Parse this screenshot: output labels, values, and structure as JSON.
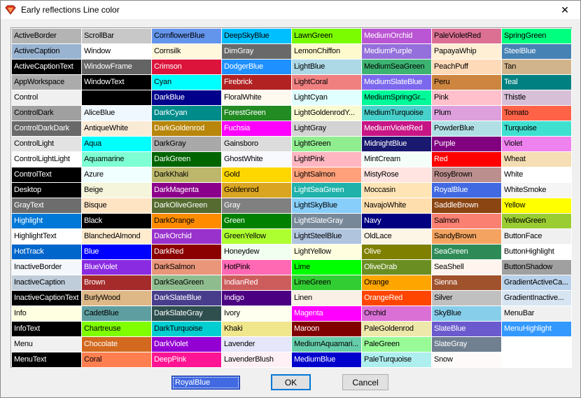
{
  "window": {
    "title": "Early reflections Line color",
    "close_glyph": "✕",
    "icon": "diamond-app-icon"
  },
  "selected": {
    "value": "RoyalBlue",
    "color": "#4169e1"
  },
  "buttons": {
    "ok": "OK",
    "cancel": "Cancel"
  },
  "columns": [
    [
      {
        "label": "ActiveBorder",
        "bg": "#b4b4b4",
        "fg": "#000000"
      },
      {
        "label": "ActiveCaption",
        "bg": "#99b4d1",
        "fg": "#000000"
      },
      {
        "label": "ActiveCaptionText",
        "bg": "#000000",
        "fg": "#ffffff"
      },
      {
        "label": "AppWorkspace",
        "bg": "#ababab",
        "fg": "#000000"
      },
      {
        "label": "Control",
        "bg": "#f0f0f0",
        "fg": "#000000"
      },
      {
        "label": "ControlDark",
        "bg": "#a0a0a0",
        "fg": "#000000"
      },
      {
        "label": "ControlDarkDark",
        "bg": "#696969",
        "fg": "#ffffff"
      },
      {
        "label": "ControlLight",
        "bg": "#e3e3e3",
        "fg": "#000000"
      },
      {
        "label": "ControlLightLight",
        "bg": "#ffffff",
        "fg": "#000000"
      },
      {
        "label": "ControlText",
        "bg": "#000000",
        "fg": "#ffffff"
      },
      {
        "label": "Desktop",
        "bg": "#000000",
        "fg": "#ffffff"
      },
      {
        "label": "GrayText",
        "bg": "#6d6d6d",
        "fg": "#ffffff"
      },
      {
        "label": "Highlight",
        "bg": "#0078d7",
        "fg": "#ffffff"
      },
      {
        "label": "HighlightText",
        "bg": "#ffffff",
        "fg": "#000000"
      },
      {
        "label": "HotTrack",
        "bg": "#0066cc",
        "fg": "#ffffff"
      },
      {
        "label": "InactiveBorder",
        "bg": "#f4f7fc",
        "fg": "#000000"
      },
      {
        "label": "InactiveCaption",
        "bg": "#bfcddb",
        "fg": "#000000"
      },
      {
        "label": "InactiveCaptionText",
        "bg": "#000000",
        "fg": "#ffffff"
      },
      {
        "label": "Info",
        "bg": "#ffffe1",
        "fg": "#000000"
      },
      {
        "label": "InfoText",
        "bg": "#000000",
        "fg": "#ffffff"
      },
      {
        "label": "Menu",
        "bg": "#f0f0f0",
        "fg": "#000000"
      },
      {
        "label": "MenuText",
        "bg": "#000000",
        "fg": "#ffffff"
      }
    ],
    [
      {
        "label": "ScrollBar",
        "bg": "#c8c8c8",
        "fg": "#000000"
      },
      {
        "label": "Window",
        "bg": "#ffffff",
        "fg": "#000000"
      },
      {
        "label": "WindowFrame",
        "bg": "#646464",
        "fg": "#ffffff"
      },
      {
        "label": "WindowText",
        "bg": "#000000",
        "fg": "#ffffff"
      },
      {
        "label": "",
        "bg": "#000000",
        "fg": "#ffffff"
      },
      {
        "label": "AliceBlue",
        "bg": "#f0f8ff",
        "fg": "#000000"
      },
      {
        "label": "AntiqueWhite",
        "bg": "#faebd7",
        "fg": "#000000"
      },
      {
        "label": "Aqua",
        "bg": "#00ffff",
        "fg": "#000000"
      },
      {
        "label": "Aquamarine",
        "bg": "#7fffd4",
        "fg": "#000000"
      },
      {
        "label": "Azure",
        "bg": "#f0ffff",
        "fg": "#000000"
      },
      {
        "label": "Beige",
        "bg": "#f5f5dc",
        "fg": "#000000"
      },
      {
        "label": "Bisque",
        "bg": "#ffe4c4",
        "fg": "#000000"
      },
      {
        "label": "Black",
        "bg": "#000000",
        "fg": "#ffffff"
      },
      {
        "label": "BlanchedAlmond",
        "bg": "#ffebcd",
        "fg": "#000000"
      },
      {
        "label": "Blue",
        "bg": "#0000ff",
        "fg": "#ffffff"
      },
      {
        "label": "BlueViolet",
        "bg": "#8a2be2",
        "fg": "#ffffff"
      },
      {
        "label": "Brown",
        "bg": "#a52a2a",
        "fg": "#ffffff"
      },
      {
        "label": "BurlyWood",
        "bg": "#deb887",
        "fg": "#000000"
      },
      {
        "label": "CadetBlue",
        "bg": "#5f9ea0",
        "fg": "#000000"
      },
      {
        "label": "Chartreuse",
        "bg": "#7fff00",
        "fg": "#000000"
      },
      {
        "label": "Chocolate",
        "bg": "#d2691e",
        "fg": "#ffffff"
      },
      {
        "label": "Coral",
        "bg": "#ff7f50",
        "fg": "#000000"
      }
    ],
    [
      {
        "label": "CornflowerBlue",
        "bg": "#6495ed",
        "fg": "#000000"
      },
      {
        "label": "Cornsilk",
        "bg": "#fff8dc",
        "fg": "#000000"
      },
      {
        "label": "Crimson",
        "bg": "#dc143c",
        "fg": "#ffffff"
      },
      {
        "label": "Cyan",
        "bg": "#00ffff",
        "fg": "#000000"
      },
      {
        "label": "DarkBlue",
        "bg": "#00008b",
        "fg": "#ffffff"
      },
      {
        "label": "DarkCyan",
        "bg": "#008b8b",
        "fg": "#ffffff"
      },
      {
        "label": "DarkGoldenrod",
        "bg": "#b8860b",
        "fg": "#ffffff"
      },
      {
        "label": "DarkGray",
        "bg": "#a9a9a9",
        "fg": "#000000"
      },
      {
        "label": "DarkGreen",
        "bg": "#006400",
        "fg": "#ffffff"
      },
      {
        "label": "DarkKhaki",
        "bg": "#bdb76b",
        "fg": "#000000"
      },
      {
        "label": "DarkMagenta",
        "bg": "#8b008b",
        "fg": "#ffffff"
      },
      {
        "label": "DarkOliveGreen",
        "bg": "#556b2f",
        "fg": "#ffffff"
      },
      {
        "label": "DarkOrange",
        "bg": "#ff8c00",
        "fg": "#000000"
      },
      {
        "label": "DarkOrchid",
        "bg": "#9932cc",
        "fg": "#ffffff"
      },
      {
        "label": "DarkRed",
        "bg": "#8b0000",
        "fg": "#ffffff"
      },
      {
        "label": "DarkSalmon",
        "bg": "#e9967a",
        "fg": "#000000"
      },
      {
        "label": "DarkSeaGreen",
        "bg": "#8fbc8f",
        "fg": "#000000"
      },
      {
        "label": "DarkSlateBlue",
        "bg": "#483d8b",
        "fg": "#ffffff"
      },
      {
        "label": "DarkSlateGray",
        "bg": "#2f4f4f",
        "fg": "#ffffff"
      },
      {
        "label": "DarkTurquoise",
        "bg": "#00ced1",
        "fg": "#000000"
      },
      {
        "label": "DarkViolet",
        "bg": "#9400d3",
        "fg": "#ffffff"
      },
      {
        "label": "DeepPink",
        "bg": "#ff1493",
        "fg": "#ffffff"
      }
    ],
    [
      {
        "label": "DeepSkyBlue",
        "bg": "#00bfff",
        "fg": "#000000"
      },
      {
        "label": "DimGray",
        "bg": "#696969",
        "fg": "#ffffff"
      },
      {
        "label": "DodgerBlue",
        "bg": "#1e90ff",
        "fg": "#ffffff"
      },
      {
        "label": "Firebrick",
        "bg": "#b22222",
        "fg": "#ffffff"
      },
      {
        "label": "FloralWhite",
        "bg": "#fffaf0",
        "fg": "#000000"
      },
      {
        "label": "ForestGreen",
        "bg": "#228b22",
        "fg": "#ffffff"
      },
      {
        "label": "Fuchsia",
        "bg": "#ff00ff",
        "fg": "#ffffff"
      },
      {
        "label": "Gainsboro",
        "bg": "#dcdcdc",
        "fg": "#000000"
      },
      {
        "label": "GhostWhite",
        "bg": "#f8f8ff",
        "fg": "#000000"
      },
      {
        "label": "Gold",
        "bg": "#ffd700",
        "fg": "#000000"
      },
      {
        "label": "Goldenrod",
        "bg": "#daa520",
        "fg": "#000000"
      },
      {
        "label": "Gray",
        "bg": "#808080",
        "fg": "#ffffff"
      },
      {
        "label": "Green",
        "bg": "#008000",
        "fg": "#ffffff"
      },
      {
        "label": "GreenYellow",
        "bg": "#adff2f",
        "fg": "#000000"
      },
      {
        "label": "Honeydew",
        "bg": "#f0fff0",
        "fg": "#000000"
      },
      {
        "label": "HotPink",
        "bg": "#ff69b4",
        "fg": "#000000"
      },
      {
        "label": "IndianRed",
        "bg": "#cd5c5c",
        "fg": "#ffffff"
      },
      {
        "label": "Indigo",
        "bg": "#4b0082",
        "fg": "#ffffff"
      },
      {
        "label": "Ivory",
        "bg": "#fffff0",
        "fg": "#000000"
      },
      {
        "label": "Khaki",
        "bg": "#f0e68c",
        "fg": "#000000"
      },
      {
        "label": "Lavender",
        "bg": "#e6e6fa",
        "fg": "#000000"
      },
      {
        "label": "LavenderBlush",
        "bg": "#fff0f5",
        "fg": "#000000"
      }
    ],
    [
      {
        "label": "LawnGreen",
        "bg": "#7cfc00",
        "fg": "#000000"
      },
      {
        "label": "LemonChiffon",
        "bg": "#fffacd",
        "fg": "#000000"
      },
      {
        "label": "LightBlue",
        "bg": "#add8e6",
        "fg": "#000000"
      },
      {
        "label": "LightCoral",
        "bg": "#f08080",
        "fg": "#000000"
      },
      {
        "label": "LightCyan",
        "bg": "#e0ffff",
        "fg": "#000000"
      },
      {
        "label": "LightGoldenrodY...",
        "bg": "#fafad2",
        "fg": "#000000"
      },
      {
        "label": "LightGray",
        "bg": "#d3d3d3",
        "fg": "#000000"
      },
      {
        "label": "LightGreen",
        "bg": "#90ee90",
        "fg": "#000000"
      },
      {
        "label": "LightPink",
        "bg": "#ffb6c1",
        "fg": "#000000"
      },
      {
        "label": "LightSalmon",
        "bg": "#ffa07a",
        "fg": "#000000"
      },
      {
        "label": "LightSeaGreen",
        "bg": "#20b2aa",
        "fg": "#ffffff"
      },
      {
        "label": "LightSkyBlue",
        "bg": "#87cefa",
        "fg": "#000000"
      },
      {
        "label": "LightSlateGray",
        "bg": "#778899",
        "fg": "#ffffff"
      },
      {
        "label": "LightSteelBlue",
        "bg": "#b0c4de",
        "fg": "#000000"
      },
      {
        "label": "LightYellow",
        "bg": "#ffffe0",
        "fg": "#000000"
      },
      {
        "label": "Lime",
        "bg": "#00ff00",
        "fg": "#000000"
      },
      {
        "label": "LimeGreen",
        "bg": "#32cd32",
        "fg": "#000000"
      },
      {
        "label": "Linen",
        "bg": "#faf0e6",
        "fg": "#000000"
      },
      {
        "label": "Magenta",
        "bg": "#ff00ff",
        "fg": "#ffffff"
      },
      {
        "label": "Maroon",
        "bg": "#800000",
        "fg": "#ffffff"
      },
      {
        "label": "MediumAquamari...",
        "bg": "#66cdaa",
        "fg": "#000000"
      },
      {
        "label": "MediumBlue",
        "bg": "#0000cd",
        "fg": "#ffffff"
      }
    ],
    [
      {
        "label": "MediumOrchid",
        "bg": "#ba55d3",
        "fg": "#ffffff"
      },
      {
        "label": "MediumPurple",
        "bg": "#9370db",
        "fg": "#ffffff"
      },
      {
        "label": "MediumSeaGreen",
        "bg": "#3cb371",
        "fg": "#000000"
      },
      {
        "label": "MediumSlateBlue",
        "bg": "#7b68ee",
        "fg": "#ffffff"
      },
      {
        "label": "MediumSpringGr...",
        "bg": "#00fa9a",
        "fg": "#000000"
      },
      {
        "label": "MediumTurquoise",
        "bg": "#48d1cc",
        "fg": "#000000"
      },
      {
        "label": "MediumVioletRed",
        "bg": "#c71585",
        "fg": "#ffffff"
      },
      {
        "label": "MidnightBlue",
        "bg": "#191970",
        "fg": "#ffffff"
      },
      {
        "label": "MintCream",
        "bg": "#f5fffa",
        "fg": "#000000"
      },
      {
        "label": "MistyRose",
        "bg": "#ffe4e1",
        "fg": "#000000"
      },
      {
        "label": "Moccasin",
        "bg": "#ffe4b5",
        "fg": "#000000"
      },
      {
        "label": "NavajoWhite",
        "bg": "#ffdead",
        "fg": "#000000"
      },
      {
        "label": "Navy",
        "bg": "#000080",
        "fg": "#ffffff"
      },
      {
        "label": "OldLace",
        "bg": "#fdf5e6",
        "fg": "#000000"
      },
      {
        "label": "Olive",
        "bg": "#808000",
        "fg": "#ffffff"
      },
      {
        "label": "OliveDrab",
        "bg": "#6b8e23",
        "fg": "#ffffff"
      },
      {
        "label": "Orange",
        "bg": "#ffa500",
        "fg": "#000000"
      },
      {
        "label": "OrangeRed",
        "bg": "#ff4500",
        "fg": "#ffffff"
      },
      {
        "label": "Orchid",
        "bg": "#da70d6",
        "fg": "#000000"
      },
      {
        "label": "PaleGoldenrod",
        "bg": "#eee8aa",
        "fg": "#000000"
      },
      {
        "label": "PaleGreen",
        "bg": "#98fb98",
        "fg": "#000000"
      },
      {
        "label": "PaleTurquoise",
        "bg": "#afeeee",
        "fg": "#000000"
      }
    ],
    [
      {
        "label": "PaleVioletRed",
        "bg": "#db7093",
        "fg": "#000000"
      },
      {
        "label": "PapayaWhip",
        "bg": "#ffefd5",
        "fg": "#000000"
      },
      {
        "label": "PeachPuff",
        "bg": "#ffdab9",
        "fg": "#000000"
      },
      {
        "label": "Peru",
        "bg": "#cd853f",
        "fg": "#000000"
      },
      {
        "label": "Pink",
        "bg": "#ffc0cb",
        "fg": "#000000"
      },
      {
        "label": "Plum",
        "bg": "#dda0dd",
        "fg": "#000000"
      },
      {
        "label": "PowderBlue",
        "bg": "#b0e0e6",
        "fg": "#000000"
      },
      {
        "label": "Purple",
        "bg": "#800080",
        "fg": "#ffffff"
      },
      {
        "label": "Red",
        "bg": "#ff0000",
        "fg": "#ffffff"
      },
      {
        "label": "RosyBrown",
        "bg": "#bc8f8f",
        "fg": "#000000"
      },
      {
        "label": "RoyalBlue",
        "bg": "#4169e1",
        "fg": "#ffffff"
      },
      {
        "label": "SaddleBrown",
        "bg": "#8b4513",
        "fg": "#ffffff"
      },
      {
        "label": "Salmon",
        "bg": "#fa8072",
        "fg": "#000000"
      },
      {
        "label": "SandyBrown",
        "bg": "#f4a460",
        "fg": "#000000"
      },
      {
        "label": "SeaGreen",
        "bg": "#2e8b57",
        "fg": "#ffffff"
      },
      {
        "label": "SeaShell",
        "bg": "#fff5ee",
        "fg": "#000000"
      },
      {
        "label": "Sienna",
        "bg": "#a0522d",
        "fg": "#ffffff"
      },
      {
        "label": "Silver",
        "bg": "#c0c0c0",
        "fg": "#000000"
      },
      {
        "label": "SkyBlue",
        "bg": "#87ceeb",
        "fg": "#000000"
      },
      {
        "label": "SlateBlue",
        "bg": "#6a5acd",
        "fg": "#ffffff"
      },
      {
        "label": "SlateGray",
        "bg": "#708090",
        "fg": "#ffffff"
      },
      {
        "label": "Snow",
        "bg": "#fffafa",
        "fg": "#000000"
      }
    ],
    [
      {
        "label": "SpringGreen",
        "bg": "#00ff7f",
        "fg": "#000000"
      },
      {
        "label": "SteelBlue",
        "bg": "#4682b4",
        "fg": "#ffffff"
      },
      {
        "label": "Tan",
        "bg": "#d2b48c",
        "fg": "#000000"
      },
      {
        "label": "Teal",
        "bg": "#008080",
        "fg": "#ffffff"
      },
      {
        "label": "Thistle",
        "bg": "#d8bfd8",
        "fg": "#000000"
      },
      {
        "label": "Tomato",
        "bg": "#ff6347",
        "fg": "#000000"
      },
      {
        "label": "Turquoise",
        "bg": "#40e0d0",
        "fg": "#000000"
      },
      {
        "label": "Violet",
        "bg": "#ee82ee",
        "fg": "#000000"
      },
      {
        "label": "Wheat",
        "bg": "#f5deb3",
        "fg": "#000000"
      },
      {
        "label": "White",
        "bg": "#ffffff",
        "fg": "#000000"
      },
      {
        "label": "WhiteSmoke",
        "bg": "#f5f5f5",
        "fg": "#000000"
      },
      {
        "label": "Yellow",
        "bg": "#ffff00",
        "fg": "#000000"
      },
      {
        "label": "YellowGreen",
        "bg": "#9acd32",
        "fg": "#000000"
      },
      {
        "label": "ButtonFace",
        "bg": "#f0f0f0",
        "fg": "#000000"
      },
      {
        "label": "ButtonHighlight",
        "bg": "#ffffff",
        "fg": "#000000"
      },
      {
        "label": "ButtonShadow",
        "bg": "#a0a0a0",
        "fg": "#000000"
      },
      {
        "label": "GradientActiveCa...",
        "bg": "#b9d1ea",
        "fg": "#000000"
      },
      {
        "label": "GradientInactive...",
        "bg": "#d7e4f2",
        "fg": "#000000"
      },
      {
        "label": "MenuBar",
        "bg": "#f0f0f0",
        "fg": "#000000"
      },
      {
        "label": "MenuHighlight",
        "bg": "#3399ff",
        "fg": "#ffffff"
      },
      {
        "label": "",
        "bg": "#ffffff",
        "fg": "#000000"
      },
      {
        "label": "",
        "bg": "#ffffff",
        "fg": "#000000"
      }
    ]
  ]
}
